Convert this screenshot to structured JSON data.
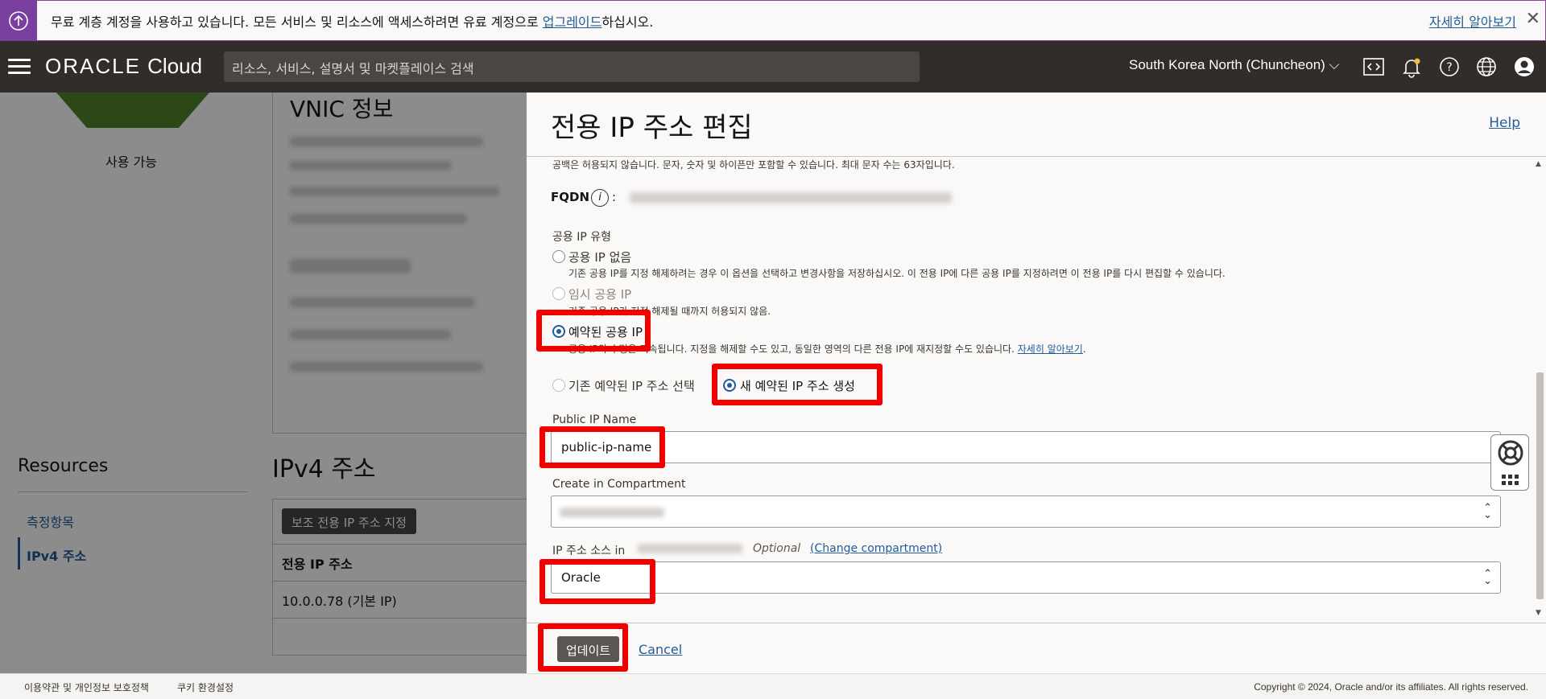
{
  "banner": {
    "text_before": "무료 계층 계정을 사용하고 있습니다. 모든 서비스 및 리소스에 액세스하려면 유료 계정으로 ",
    "upgrade_link": "업그레이드",
    "text_after": "하십시오.",
    "learn_more": "자세히 알아보기"
  },
  "header": {
    "logo_brand": "ORACLE",
    "logo_product": "Cloud",
    "search_placeholder": "리소스, 서비스, 설명서 및 마켓플레이스 검색",
    "region": "South Korea North (Chuncheon)"
  },
  "background": {
    "status": "사용 가능",
    "vnic_title": "VNIC 정보",
    "resources_title": "Resources",
    "nav": [
      "측정항목",
      "IPv4 주소"
    ],
    "ipv4_title": "IPv4 주소",
    "assign_button": "보조 전용 IP 주소 지정",
    "table_header": "전용 IP 주소",
    "table_row": "10.0.0.78 (기본 IP)"
  },
  "drawer": {
    "title": "전용 IP 주소 편집",
    "help": "Help",
    "hostname_hint": "공백은 허용되지 않습니다. 문자, 숫자 및 하이픈만 포함할 수 있습니다. 최대 문자 수는 63자입니다.",
    "fqdn_label": "FQDN",
    "public_ip_type_label": "공용 IP 유형",
    "options": [
      {
        "label": "공용 IP 없음",
        "desc": "기존 공용 IP를 지정 해제하려는 경우 이 옵션을 선택하고 변경사항을 저장하십시오. 이 전용 IP에 다른 공용 IP를 지정하려면 이 전용 IP를 다시 편집할 수 있습니다."
      },
      {
        "label": "임시 공용 IP",
        "desc": "기존 공용 IP가 지정 해제될 때까지 허용되지 않음."
      },
      {
        "label": "예약된 공용 IP",
        "desc_prefix": "공용 IP의 수명은 지속됩니다. 지정을 해제할 수도 있고, 동일한 영역의 다른 전용 IP에 재지정할 수도 있습니다.",
        "desc_link": "자세히 알아보기"
      }
    ],
    "reserved_choice": [
      "기존 예약된 IP 주소 선택",
      "새 예약된 IP 주소 생성"
    ],
    "public_ip_name_label": "Public IP Name",
    "public_ip_name_value": "public-ip-name",
    "compartment_label": "Create in Compartment",
    "ip_source_label": "IP 주소 소스 in",
    "optional": "Optional",
    "change_compartment": "(Change compartment)",
    "ip_source_value": "Oracle",
    "update_button": "업데이트",
    "cancel": "Cancel"
  },
  "footer": {
    "terms": "이용약관 및 개인정보 보호정책",
    "cookies": "쿠키 환경설정",
    "copyright": "Copyright © 2024, Oracle and/or its affiliates. All rights reserved."
  },
  "colors": {
    "highlight": "#f20000",
    "link": "#1f5c99",
    "header_bg": "#312d2a",
    "banner_accent": "#7b3fa0"
  }
}
